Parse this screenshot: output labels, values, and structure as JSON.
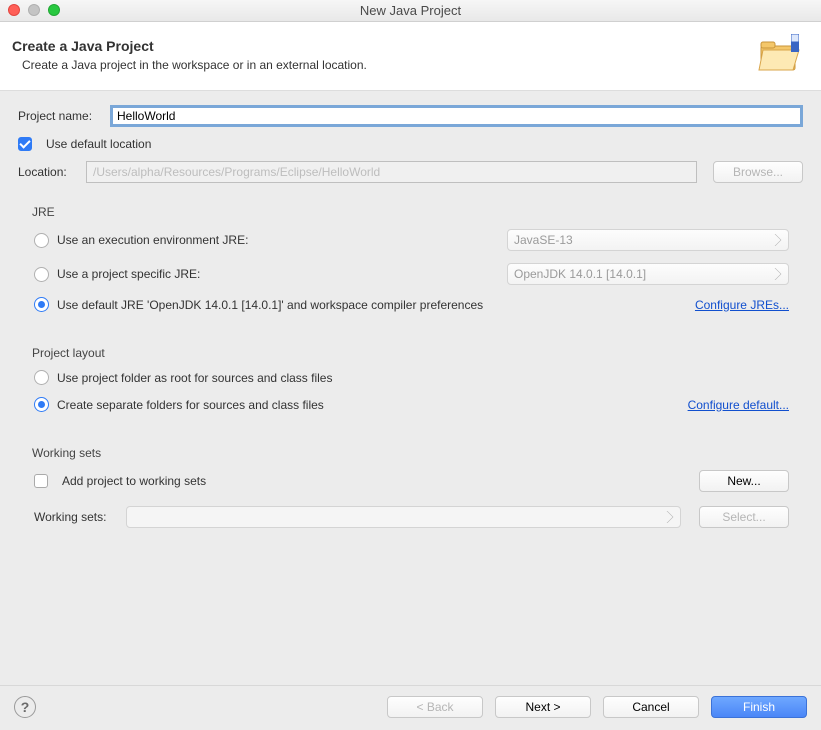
{
  "window": {
    "title": "New Java Project"
  },
  "banner": {
    "heading": "Create a Java Project",
    "subheading": "Create a Java project in the workspace or in an external location."
  },
  "project_name": {
    "label": "Project name:",
    "value": "HelloWorld"
  },
  "use_default_location": {
    "label": "Use default location",
    "checked": true
  },
  "location": {
    "label": "Location:",
    "value": "/Users/alpha/Resources/Programs/Eclipse/HelloWorld",
    "browse": "Browse..."
  },
  "jre": {
    "title": "JRE",
    "opt1": {
      "label": "Use an execution environment JRE:",
      "select": "JavaSE-13"
    },
    "opt2": {
      "label": "Use a project specific JRE:",
      "select": "OpenJDK 14.0.1 [14.0.1]"
    },
    "opt3": {
      "label": "Use default JRE 'OpenJDK 14.0.1 [14.0.1]' and workspace compiler preferences"
    },
    "selected": "opt3",
    "configure": "Configure JREs..."
  },
  "layout": {
    "title": "Project layout",
    "opt1": "Use project folder as root for sources and class files",
    "opt2": "Create separate folders for sources and class files",
    "selected": "opt2",
    "configure": "Configure default..."
  },
  "working_sets": {
    "title": "Working sets",
    "add_label": "Add project to working sets",
    "add_checked": false,
    "new": "New...",
    "label": "Working sets:",
    "select_btn": "Select..."
  },
  "footer": {
    "back": "< Back",
    "next": "Next >",
    "cancel": "Cancel",
    "finish": "Finish"
  }
}
